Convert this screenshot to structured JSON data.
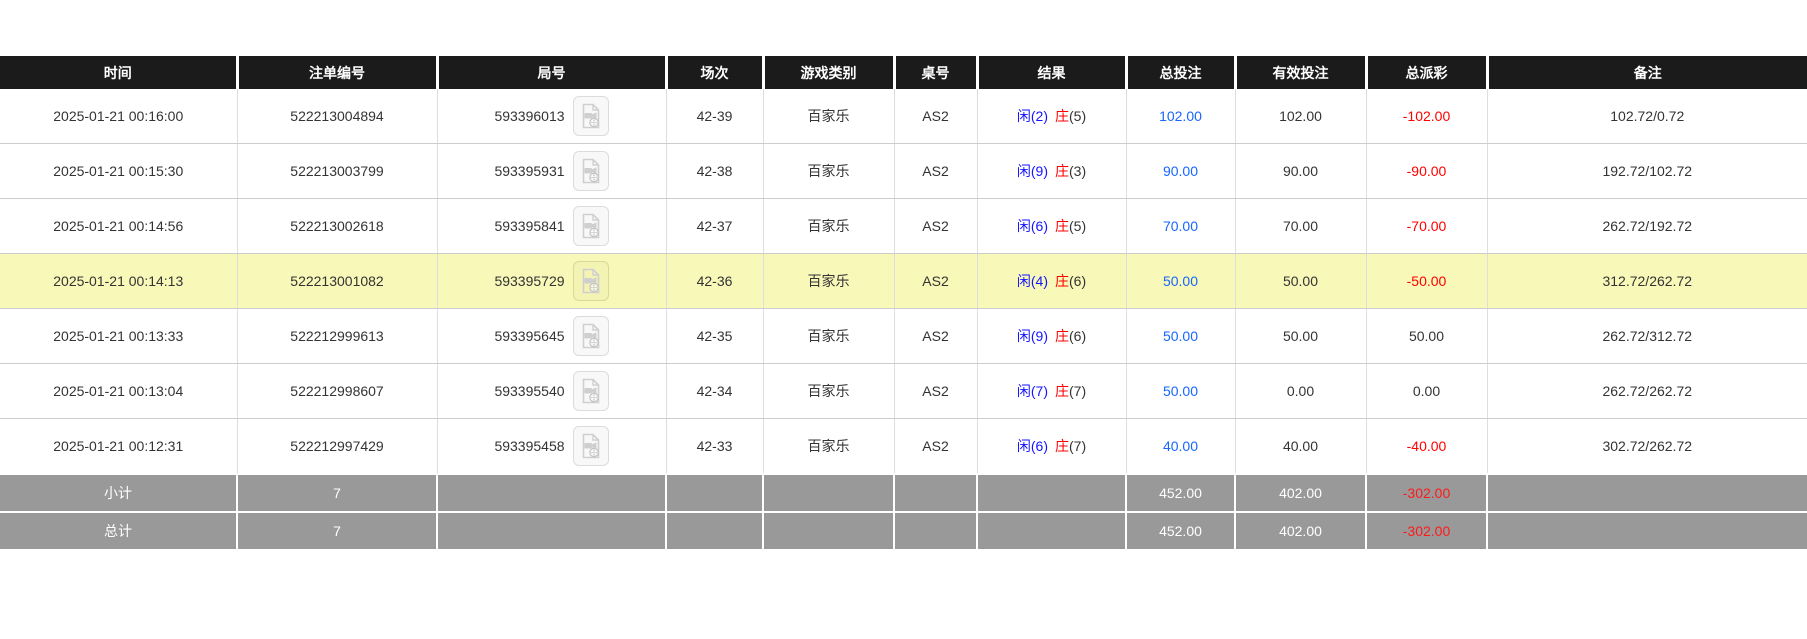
{
  "table": {
    "columns": [
      {
        "key": "time",
        "label": "时间"
      },
      {
        "key": "bet_id",
        "label": "注单编号"
      },
      {
        "key": "round_id",
        "label": "局号"
      },
      {
        "key": "session",
        "label": "场次"
      },
      {
        "key": "game_type",
        "label": "游戏类别"
      },
      {
        "key": "table_no",
        "label": "桌号"
      },
      {
        "key": "result",
        "label": "结果"
      },
      {
        "key": "total_bet",
        "label": "总投注"
      },
      {
        "key": "valid_bet",
        "label": "有效投注"
      },
      {
        "key": "total_payout",
        "label": "总派彩"
      },
      {
        "key": "remark",
        "label": "备注"
      }
    ],
    "rows": [
      {
        "time": "2025-01-21 00:16:00",
        "bet_id": "522213004894",
        "round_id": "593396013",
        "session": "42-39",
        "game_type": "百家乐",
        "table_no": "AS2",
        "result": {
          "player": "闲(2)",
          "banker": "庄",
          "banker_points": "(5)"
        },
        "total_bet": "102.00",
        "valid_bet": "102.00",
        "total_payout": "-102.00",
        "remark": "102.72/0.72"
      },
      {
        "time": "2025-01-21 00:15:30",
        "bet_id": "522213003799",
        "round_id": "593395931",
        "session": "42-38",
        "game_type": "百家乐",
        "table_no": "AS2",
        "result": {
          "player": "闲(9)",
          "banker": "庄",
          "banker_points": "(3)"
        },
        "total_bet": "90.00",
        "valid_bet": "90.00",
        "total_payout": "-90.00",
        "remark": "192.72/102.72"
      },
      {
        "time": "2025-01-21 00:14:56",
        "bet_id": "522213002618",
        "round_id": "593395841",
        "session": "42-37",
        "game_type": "百家乐",
        "table_no": "AS2",
        "result": {
          "player": "闲(6)",
          "banker": "庄",
          "banker_points": "(5)"
        },
        "total_bet": "70.00",
        "valid_bet": "70.00",
        "total_payout": "-70.00",
        "remark": "262.72/192.72"
      },
      {
        "time": "2025-01-21 00:14:13",
        "bet_id": "522213001082",
        "round_id": "593395729",
        "session": "42-36",
        "game_type": "百家乐",
        "table_no": "AS2",
        "result": {
          "player": "闲(4)",
          "banker": "庄",
          "banker_points": "(6)"
        },
        "total_bet": "50.00",
        "valid_bet": "50.00",
        "total_payout": "-50.00",
        "remark": "312.72/262.72",
        "highlighted": true
      },
      {
        "time": "2025-01-21 00:13:33",
        "bet_id": "522212999613",
        "round_id": "593395645",
        "session": "42-35",
        "game_type": "百家乐",
        "table_no": "AS2",
        "result": {
          "player": "闲(9)",
          "banker": "庄",
          "banker_points": "(6)"
        },
        "total_bet": "50.00",
        "valid_bet": "50.00",
        "total_payout": "50.00",
        "remark": "262.72/312.72"
      },
      {
        "time": "2025-01-21 00:13:04",
        "bet_id": "522212998607",
        "round_id": "593395540",
        "session": "42-34",
        "game_type": "百家乐",
        "table_no": "AS2",
        "result": {
          "player": "闲(7)",
          "banker": "庄",
          "banker_points": "(7)"
        },
        "total_bet": "50.00",
        "valid_bet": "0.00",
        "total_payout": "0.00",
        "remark": "262.72/262.72"
      },
      {
        "time": "2025-01-21 00:12:31",
        "bet_id": "522212997429",
        "round_id": "593395458",
        "session": "42-33",
        "game_type": "百家乐",
        "table_no": "AS2",
        "result": {
          "player": "闲(6)",
          "banker": "庄",
          "banker_points": "(7)"
        },
        "total_bet": "40.00",
        "valid_bet": "40.00",
        "total_payout": "-40.00",
        "remark": "302.72/262.72"
      }
    ],
    "subtotal": {
      "label": "小计",
      "count": "7",
      "total_bet": "452.00",
      "valid_bet": "402.00",
      "total_payout": "-302.00"
    },
    "grand_total": {
      "label": "总计",
      "count": "7",
      "total_bet": "452.00",
      "valid_bet": "402.00",
      "total_payout": "-302.00"
    }
  },
  "icons": {
    "round_video": "video-replay-icon"
  },
  "colors": {
    "header_bg": "#1b1b1b",
    "header_text": "#ffffff",
    "row_highlight": "#f8f8b9",
    "summary_bg": "#999999",
    "amount_blue": "#1766ff",
    "loss_red": "#ff0000",
    "player_blue": "#1414ff",
    "banker_red": "#ff0000",
    "body_text": "#333333"
  }
}
